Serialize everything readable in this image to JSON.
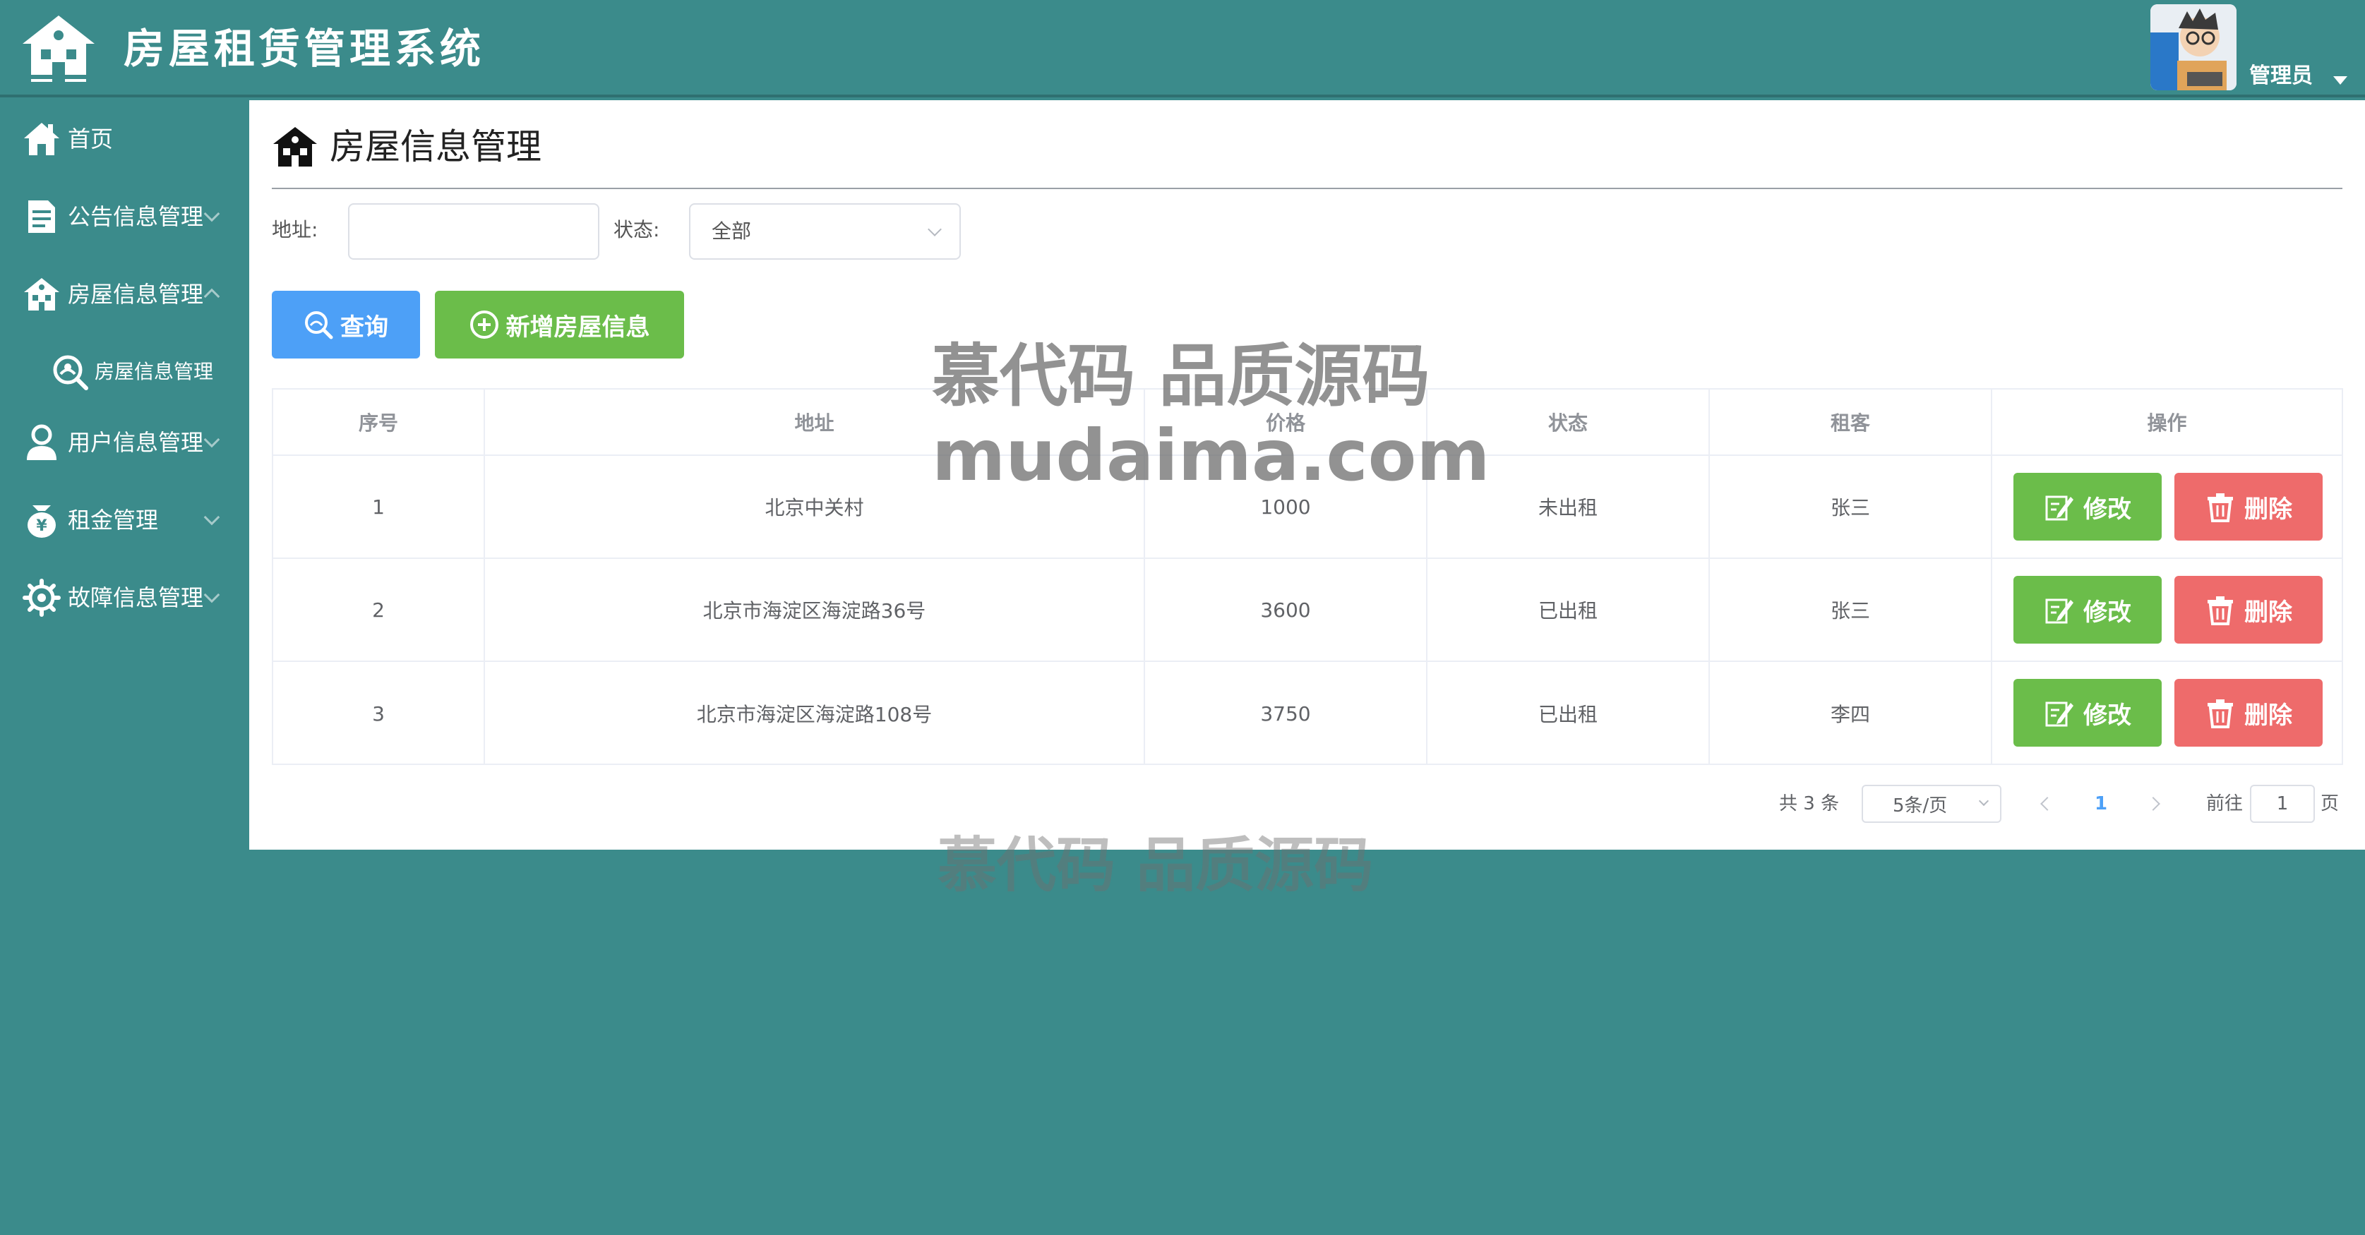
{
  "app": {
    "title": "房屋租赁管理系统",
    "user_name": "管理员"
  },
  "sidebar": {
    "items": [
      {
        "label": "首页",
        "icon": "home-icon"
      },
      {
        "label": "公告信息管理",
        "icon": "notice-icon"
      },
      {
        "label": "房屋信息管理",
        "icon": "house-icon"
      },
      {
        "label": "房屋信息管理",
        "icon": "search-icon"
      },
      {
        "label": "用户信息管理",
        "icon": "user-icon"
      },
      {
        "label": "租金管理",
        "icon": "money-icon"
      },
      {
        "label": "故障信息管理",
        "icon": "gear-icon"
      }
    ]
  },
  "main": {
    "heading": "房屋信息管理",
    "filters": {
      "address_label": "地址:",
      "address_value": "",
      "status_label": "状态:",
      "status_value": "全部"
    },
    "buttons": {
      "query": "查询",
      "add": "新增房屋信息"
    },
    "table": {
      "columns": [
        "序号",
        "地址",
        "价格",
        "状态",
        "租客",
        "操作"
      ],
      "rows": [
        {
          "index": "1",
          "address": "北京中关村",
          "price": "1000",
          "status": "未出租",
          "tenant": "张三"
        },
        {
          "index": "2",
          "address": "北京市海淀区海淀路36号",
          "price": "3600",
          "status": "已出租",
          "tenant": "张三"
        },
        {
          "index": "3",
          "address": "北京市海淀区海淀路108号",
          "price": "3750",
          "status": "已出租",
          "tenant": "李四"
        }
      ],
      "edit_label": "修改",
      "delete_label": "删除"
    },
    "pagination": {
      "total": "共 3 条",
      "page_size": "5条/页",
      "current_page": "1",
      "goto_label": "前往",
      "goto_value": "1",
      "page_suffix": "页"
    }
  },
  "watermark": {
    "line1": "慕代码 品质源码",
    "line2": "mudaima.com",
    "line3": "慕代码 品质源码"
  },
  "colors": {
    "theme": "#3b8b8b",
    "primary": "#4da0f7",
    "success": "#6bbd4a",
    "danger": "#ee6b6b"
  }
}
